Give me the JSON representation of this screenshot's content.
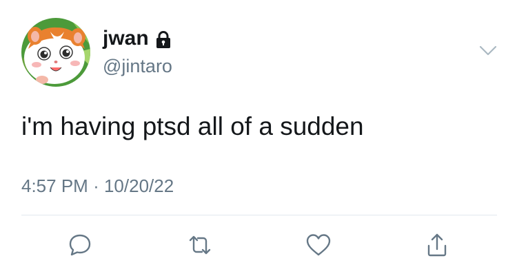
{
  "tweet": {
    "author": {
      "display_name": "jwan",
      "handle": "@jintaro",
      "avatar": "hamster-cartoon-avatar",
      "protected_icon": "lock-icon"
    },
    "text": "i'm having ptsd all of a sudden",
    "time": "4:57 PM",
    "separator": "·",
    "date": "10/20/22",
    "menu_icon": "chevron-down-icon"
  },
  "actions": [
    {
      "name": "reply",
      "icon": "speech-bubble-icon"
    },
    {
      "name": "retweet",
      "icon": "retweet-icon"
    },
    {
      "name": "like",
      "icon": "heart-icon"
    },
    {
      "name": "share",
      "icon": "share-icon"
    }
  ],
  "colors": {
    "text": "#14171a",
    "secondary": "#657786",
    "divider": "#e1e8ed",
    "avatar_background": "#4c9a3a",
    "hamster_orange": "#e9812f"
  }
}
